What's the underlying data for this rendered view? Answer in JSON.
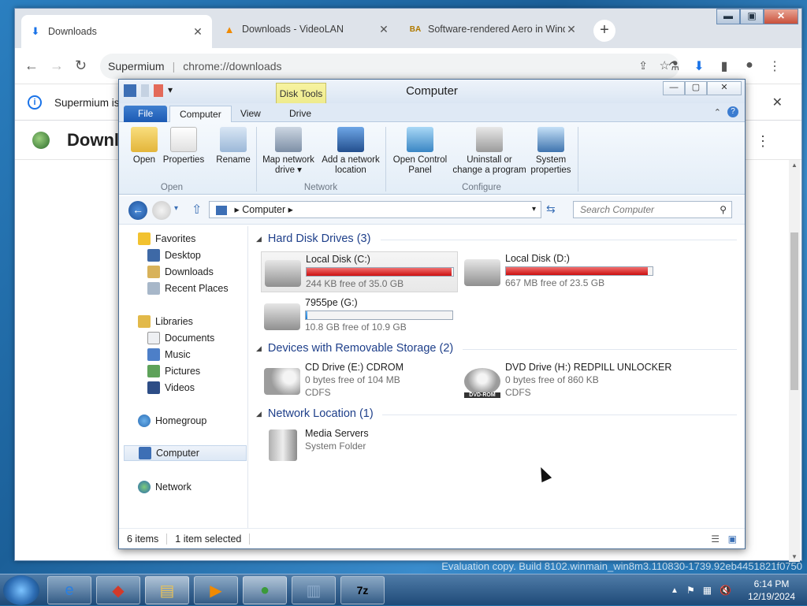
{
  "browser": {
    "tabs": [
      {
        "title": "Downloads",
        "icon": "download-icon"
      },
      {
        "title": "Downloads - VideoLAN",
        "icon": "vlc-icon"
      },
      {
        "title": "Software-rendered Aero in Windows",
        "icon": "site-icon"
      }
    ],
    "omnibox": {
      "site": "Supermium",
      "url": "chrome://downloads"
    },
    "infobar": "Supermium is",
    "page_title": "Downl"
  },
  "explorer": {
    "title": "Computer",
    "contextual_tab": "Disk Tools",
    "ribbon_tabs": [
      "File",
      "Computer",
      "View",
      "Drive"
    ],
    "ribbon_buttons": {
      "open": "Open",
      "properties": "Properties",
      "rename": "Rename",
      "map_network": "Map network drive ▾",
      "add_network": "Add a network location",
      "control_panel": "Open Control Panel",
      "uninstall": "Uninstall or change a program",
      "system_props": "System properties"
    },
    "ribbon_groups": {
      "open": "Open",
      "network": "Network",
      "configure": "Configure"
    },
    "breadcrumb": "Computer",
    "search_placeholder": "Search Computer",
    "nav": {
      "favorites": "Favorites",
      "desktop": "Desktop",
      "downloads": "Downloads",
      "recent": "Recent Places",
      "libraries": "Libraries",
      "documents": "Documents",
      "music": "Music",
      "pictures": "Pictures",
      "videos": "Videos",
      "homegroup": "Homegroup",
      "computer": "Computer",
      "network": "Network"
    },
    "groups": {
      "hdd": "Hard Disk Drives (3)",
      "removable": "Devices with Removable Storage (2)",
      "netloc": "Network Location (1)"
    },
    "drives": [
      {
        "name": "Local Disk (C:)",
        "free": "244 KB free of 35.0 GB",
        "fill": 0.99
      },
      {
        "name": "Local Disk (D:)",
        "free": "667 MB free of 23.5 GB",
        "fill": 0.97
      },
      {
        "name": "7955pe (G:)",
        "free": "10.8 GB free of 10.9 GB",
        "fill": 0.01
      }
    ],
    "removable": [
      {
        "name": "CD Drive (E:) CDROM",
        "line2": "0 bytes free of 104 MB",
        "line3": "CDFS"
      },
      {
        "name": "DVD Drive (H:) REDPILL UNLOCKER",
        "line2": "0 bytes free of 860 KB",
        "line3": "CDFS",
        "badge": "DVD-ROM"
      }
    ],
    "netloc": {
      "name": "Media Servers",
      "type": "System Folder"
    },
    "status": {
      "items": "6 items",
      "selected": "1 item selected"
    }
  },
  "watermark": "Evaluation copy. Build 8102.winmain_win8m3.110830-1739.92eb4451821f0750",
  "clock": {
    "time": "6:14 PM",
    "date": "12/19/2024"
  }
}
